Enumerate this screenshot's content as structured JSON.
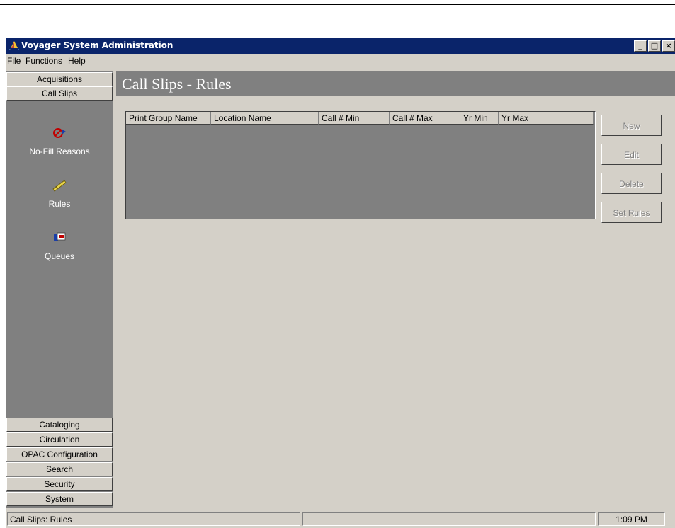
{
  "window": {
    "title": "Voyager System Administration",
    "minimize": "_",
    "maximize": "□",
    "close": "×"
  },
  "menu": [
    "File",
    "Functions",
    "Help"
  ],
  "sidebar": {
    "top_sections": [
      "Acquisitions",
      "Call Slips"
    ],
    "tools": [
      {
        "label": "No-Fill Reasons",
        "icon": "no-fill-reasons-icon"
      },
      {
        "label": "Rules",
        "icon": "ruler-icon"
      },
      {
        "label": "Queues",
        "icon": "queues-icon"
      }
    ],
    "bottom_sections": [
      "Cataloging",
      "Circulation",
      "OPAC Configuration",
      "Search",
      "Security",
      "System"
    ]
  },
  "main": {
    "title": "Call Slips - Rules",
    "columns": [
      "Print Group Name",
      "Location Name",
      "Call # Min",
      "Call # Max",
      "Yr Min",
      "Yr Max"
    ],
    "rows": [],
    "buttons": [
      "New",
      "Edit",
      "Delete",
      "Set Rules"
    ]
  },
  "status": {
    "text": "Call Slips:  Rules",
    "middle": "",
    "time": "1:09 PM"
  }
}
